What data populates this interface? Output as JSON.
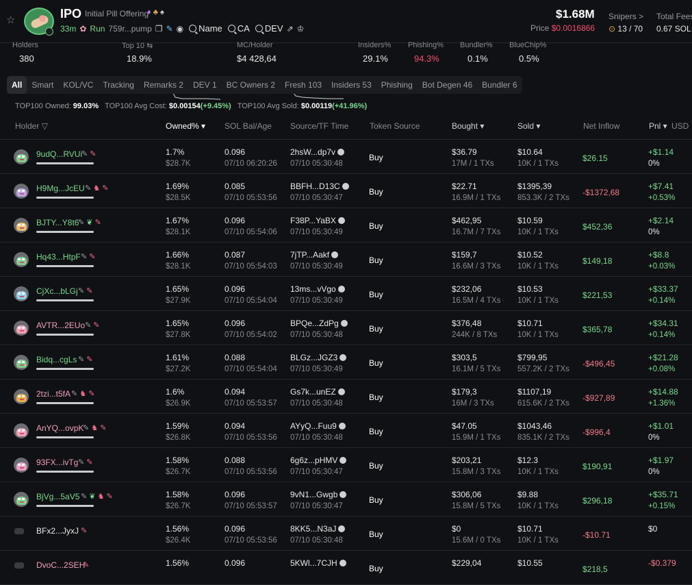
{
  "header": {
    "symbol": "IPO",
    "name": "Initial Pill Offering",
    "age": "33m",
    "run": "Run",
    "address": "759r...pump",
    "search_name": "Name",
    "search_ca": "CA",
    "search_dev": "DEV",
    "market_cap": "$1.68M",
    "price_label": "Price",
    "price_value": "$0.0016866",
    "snipers_label": "Snipers >",
    "snipers_value": "13 / 70",
    "fees_label": "Total Fees",
    "fees_value": "0.67 SOL"
  },
  "stats": [
    {
      "label": "Holders",
      "value": "380"
    },
    {
      "label": "Top 10 ⇆",
      "value": "18.9%"
    },
    {
      "label": "MC/Holder",
      "value": "$4 428,64"
    },
    {
      "label": "Insiders%",
      "value": "29.1%"
    },
    {
      "label": "Phishing%",
      "value": "94.3%"
    },
    {
      "label": "Bundler%",
      "value": "0.1%"
    },
    {
      "label": "BlueChip%",
      "value": "0.5%"
    }
  ],
  "tabs": [
    "All",
    "Smart",
    "KOL/VC",
    "Tracking",
    "Remarks 2",
    "DEV 1",
    "BC Owners 2",
    "Fresh 103",
    "Insiders 53",
    "Phishing",
    "Bot Degen 46",
    "Bundler 6"
  ],
  "summary": {
    "owned_label": "TOP100 Owned:",
    "owned_value": "99.03%",
    "cost_label": "TOP100 Avg Cost:",
    "cost_value": "$0.00154",
    "cost_change": "(+9.45%)",
    "sold_label": "TOP100 Avg Sold:",
    "sold_value": "$0.00119",
    "sold_change": "(+41.96%)"
  },
  "columns": {
    "holder": "Holder",
    "owned": "Owned% ▾",
    "sol": "SOL Bal/Age",
    "source": "Source/TF Time",
    "token_source": "Token Source",
    "bought": "Bought ▾",
    "sold": "Sold ▾",
    "net_inflow": "Net Inflow",
    "pnl": "Pnl ▾",
    "usd": "USD"
  },
  "rows": [
    {
      "holder": "9udQ...RVUi",
      "owned": "1.7%",
      "owned_usd": "$28.7K",
      "sol": "0.096",
      "age": "07/10 06:20:26",
      "src": "2hsW...dp7v",
      "src_time": "07/10 05:30:48",
      "token_src": "Buy",
      "bought": "$36.79",
      "bought_sub": "17M / 1 TXs",
      "sold": "$10.64",
      "sold_sub": "10K / 1 TXs",
      "net": "$26.15",
      "pnl": "+$1.14",
      "pnl_pct": "0%"
    },
    {
      "holder": "H9Mg...JcEU",
      "owned": "1.69%",
      "owned_usd": "$28.5K",
      "sol": "0.085",
      "age": "07/10 05:53:56",
      "src": "BBFH...D13C",
      "src_time": "07/10 05:30:47",
      "token_src": "Buy",
      "bought": "$22.71",
      "bought_sub": "16.9M / 1 TXs",
      "sold": "$1395,39",
      "sold_sub": "853.3K / 2 TXs",
      "net": "-$1372,68",
      "pnl": "+$7.41",
      "pnl_pct": "+0.53%"
    },
    {
      "holder": "BJTY...Y8t6",
      "owned": "1.67%",
      "owned_usd": "$28.1K",
      "sol": "0.096",
      "age": "07/10 05:54:06",
      "src": "F38P...YaBX",
      "src_time": "07/10 05:30:49",
      "token_src": "Buy",
      "bought": "$462,95",
      "bought_sub": "16.7M / 7 TXs",
      "sold": "$10.59",
      "sold_sub": "10K / 1 TXs",
      "net": "$452,36",
      "pnl": "+$2.14",
      "pnl_pct": "0%"
    },
    {
      "holder": "Hq43...HtpF",
      "owned": "1.66%",
      "owned_usd": "$28.1K",
      "sol": "0.087",
      "age": "07/10 05:54:03",
      "src": "7jTP...Aakf",
      "src_time": "07/10 05:30:49",
      "token_src": "Buy",
      "bought": "$159,7",
      "bought_sub": "16.6M / 3 TXs",
      "sold": "$10.52",
      "sold_sub": "10K / 1 TXs",
      "net": "$149,18",
      "pnl": "+$8.8",
      "pnl_pct": "+0.03%"
    },
    {
      "holder": "CjXc...bLGj",
      "owned": "1.65%",
      "owned_usd": "$27.9K",
      "sol": "0.096",
      "age": "07/10 05:54:04",
      "src": "13ms...vVgo",
      "src_time": "07/10 05:30:49",
      "token_src": "Buy",
      "bought": "$232,06",
      "bought_sub": "16.5M / 4 TXs",
      "sold": "$10.53",
      "sold_sub": "10K / 1 TXs",
      "net": "$221,53",
      "pnl": "+$33.37",
      "pnl_pct": "+0.14%"
    },
    {
      "holder": "AVTR...2EUo",
      "owned": "1.65%",
      "owned_usd": "$27.8K",
      "sol": "0.096",
      "age": "07/10 05:54:02",
      "src": "BPQe...ZdPg",
      "src_time": "07/10 05:30:48",
      "token_src": "Buy",
      "bought": "$376,48",
      "bought_sub": "244K / 8 TXs",
      "sold": "$10.71",
      "sold_sub": "10K / 1 TXs",
      "net": "$365,78",
      "pnl": "+$34.31",
      "pnl_pct": "+0.14%"
    },
    {
      "holder": "Bidq...cgLs",
      "owned": "1.61%",
      "owned_usd": "$27.2K",
      "sol": "0.088",
      "age": "07/10 05:54:04",
      "src": "BLGz...JGZ3",
      "src_time": "07/10 05:30:49",
      "token_src": "Buy",
      "bought": "$303,5",
      "bought_sub": "16.1M / 5 TXs",
      "sold": "$799,95",
      "sold_sub": "557.2K / 2 TXs",
      "net": "-$496,45",
      "pnl": "+$21.28",
      "pnl_pct": "+0.08%"
    },
    {
      "holder": "2tzi...t5fA",
      "owned": "1.6%",
      "owned_usd": "$26.9K",
      "sol": "0.094",
      "age": "07/10 05:53:57",
      "src": "Gs7k...unEZ",
      "src_time": "07/10 05:30:48",
      "token_src": "Buy",
      "bought": "$179,3",
      "bought_sub": "16M / 3 TXs",
      "sold": "$1107,19",
      "sold_sub": "615.6K / 2 TXs",
      "net": "-$927,89",
      "pnl": "+$14.88",
      "pnl_pct": "+1.36%"
    },
    {
      "holder": "AnYQ...ovpK",
      "owned": "1.59%",
      "owned_usd": "$26.8K",
      "sol": "0.094",
      "age": "07/10 05:53:56",
      "src": "AYyQ...Fuu9",
      "src_time": "07/10 05:30:48",
      "token_src": "Buy",
      "bought": "$47.05",
      "bought_sub": "15.9M / 1 TXs",
      "sold": "$1043,46",
      "sold_sub": "835.1K / 2 TXs",
      "net": "-$996,4",
      "pnl": "+$1.01",
      "pnl_pct": "0%"
    },
    {
      "holder": "93FX...ivTg",
      "owned": "1.58%",
      "owned_usd": "$26.7K",
      "sol": "0.088",
      "age": "07/10 05:53:56",
      "src": "6g6z...pHMV",
      "src_time": "07/10 05:30:47",
      "token_src": "Buy",
      "bought": "$203,21",
      "bought_sub": "15.8M / 3 TXs",
      "sold": "$12.3",
      "sold_sub": "10K / 1 TXs",
      "net": "$190,91",
      "pnl": "+$1.97",
      "pnl_pct": "0%"
    },
    {
      "holder": "BjVg...5aV5",
      "owned": "1.58%",
      "owned_usd": "$26.7K",
      "sol": "0.096",
      "age": "07/10 05:53:57",
      "src": "9vN1...Gwgb",
      "src_time": "07/10 05:30:47",
      "token_src": "Buy",
      "bought": "$306,06",
      "bought_sub": "15.8M / 5 TXs",
      "sold": "$9.88",
      "sold_sub": "10K / 1 TXs",
      "net": "$296,18",
      "pnl": "+$35.71",
      "pnl_pct": "+0.15%"
    },
    {
      "holder": "BFx2...JyxJ",
      "owned": "1.56%",
      "owned_usd": "$26.4K",
      "sol": "0.096",
      "age": "07/10 05:53:56",
      "src": "8KK5...N3aJ",
      "src_time": "07/10 05:30:48",
      "token_src": "Buy",
      "bought": "$0",
      "bought_sub": "15.6M / 0 TXs",
      "sold": "$10.71",
      "sold_sub": "10K / 1 TXs",
      "net": "-$10.71",
      "pnl": "$0",
      "pnl_pct": ""
    },
    {
      "holder": "DvoC...2SEH",
      "owned": "1.56%",
      "owned_usd": "",
      "sol": "0.096",
      "age": "",
      "src": "5KWl...7CJH",
      "src_time": "",
      "token_src": "Buy",
      "bought": "$229,04",
      "bought_sub": "",
      "sold": "$10.55",
      "sold_sub": "",
      "net": "$218,5",
      "pnl": "-$0.379",
      "pnl_pct": ""
    }
  ]
}
